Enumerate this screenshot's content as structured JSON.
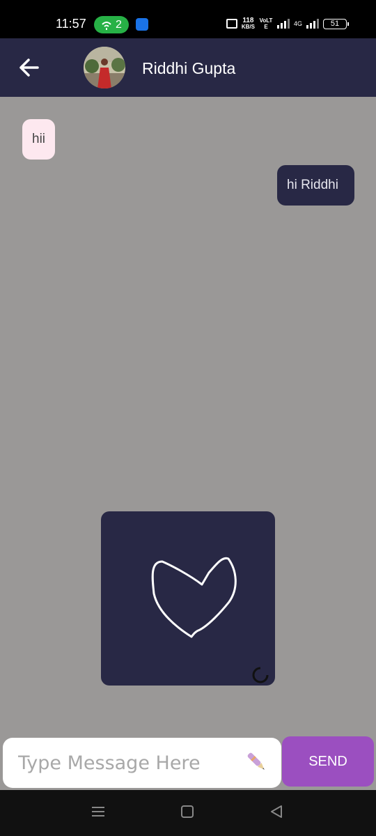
{
  "status_bar": {
    "time": "11:57",
    "hotspot_count": "2",
    "net_speed_value": "118",
    "net_speed_unit": "KB/S",
    "volte": "VoLTE",
    "network": "4G",
    "battery": "51"
  },
  "header": {
    "contact_name": "Riddhi Gupta",
    "back_icon": "arrow-left-icon",
    "avatar_icon": "profile-photo"
  },
  "messages": [
    {
      "direction": "incoming",
      "text": "hii"
    },
    {
      "direction": "outgoing",
      "text": "hi Riddhi"
    },
    {
      "direction": "outgoing",
      "type": "drawing",
      "drawing_icon": "hand-drawn-heart",
      "status_icon": "loading-spinner-icon"
    }
  ],
  "composer": {
    "placeholder": "Type Message Here",
    "send_label": "SEND",
    "pen_icon": "pen-icon"
  },
  "nav": {
    "menu_icon": "menu-icon",
    "home_icon": "home-icon",
    "back_icon": "back-triangle-icon"
  },
  "colors": {
    "header_bg": "#282845",
    "chat_bg": "#9a9897",
    "incoming_bubble": "#fde8ef",
    "outgoing_bubble": "#282845",
    "send_button": "#9b4fc0"
  }
}
